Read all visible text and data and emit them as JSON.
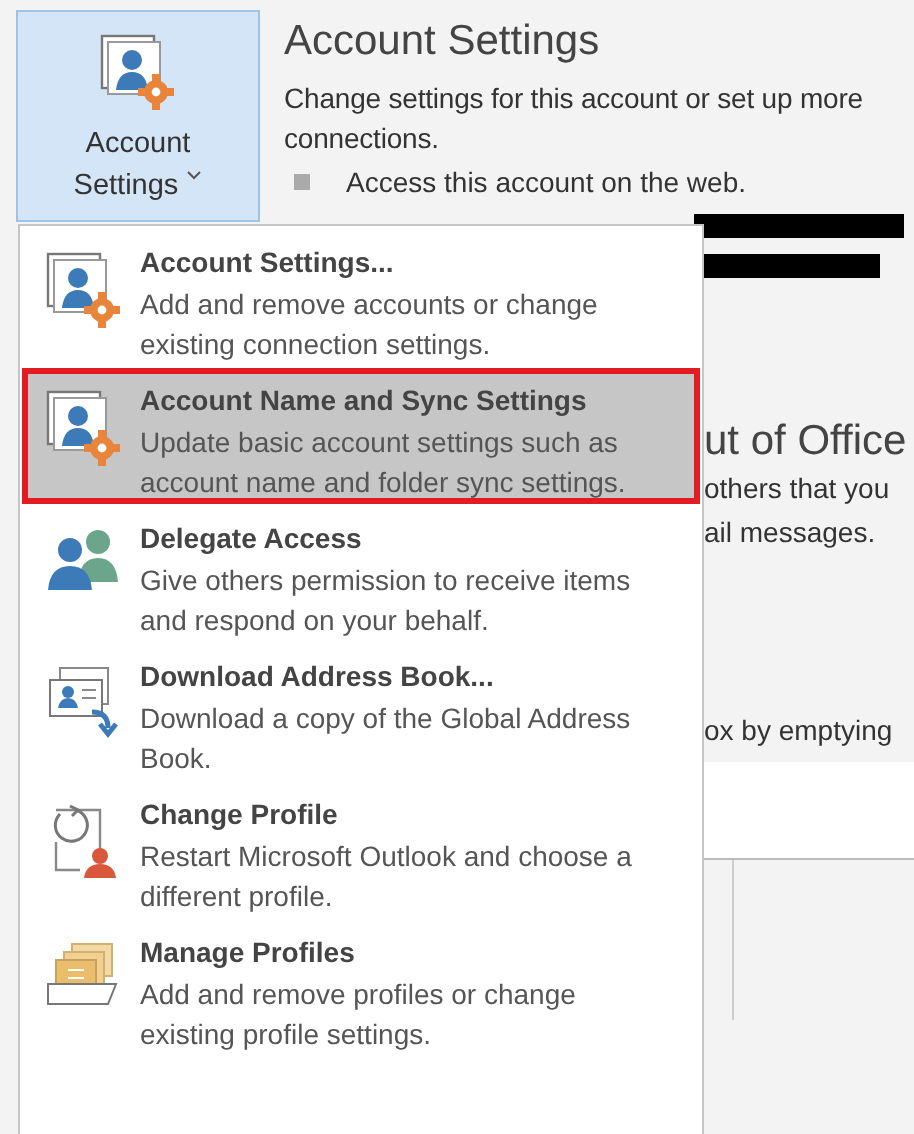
{
  "ribbon_button": {
    "label": "Account Settings"
  },
  "account_settings": {
    "title": "Account Settings",
    "description": "Change settings for this account or set up more connections.",
    "bullet": "Access this account on the web."
  },
  "out_of_office": {
    "title": "ut of Office",
    "lines": [
      "others that you",
      "ail messages."
    ]
  },
  "cleanup": {
    "text": "ox by emptying"
  },
  "menu": {
    "items": [
      {
        "title": "Account Settings...",
        "description": "Add and remove accounts or change existing connection settings.",
        "selected": false
      },
      {
        "title": "Account Name and Sync Settings",
        "description": "Update basic account settings such as account name and folder sync settings.",
        "selected": true
      },
      {
        "title": "Delegate Access",
        "description": "Give others permission to receive items and respond on your behalf.",
        "selected": false
      },
      {
        "title": "Download Address Book...",
        "description": "Download a copy of the Global Address Book.",
        "selected": false
      },
      {
        "title": "Change Profile",
        "description": "Restart Microsoft Outlook and choose a different profile.",
        "selected": false
      },
      {
        "title": "Manage Profiles",
        "description": "Add and remove profiles or change existing profile settings.",
        "selected": false
      }
    ]
  }
}
